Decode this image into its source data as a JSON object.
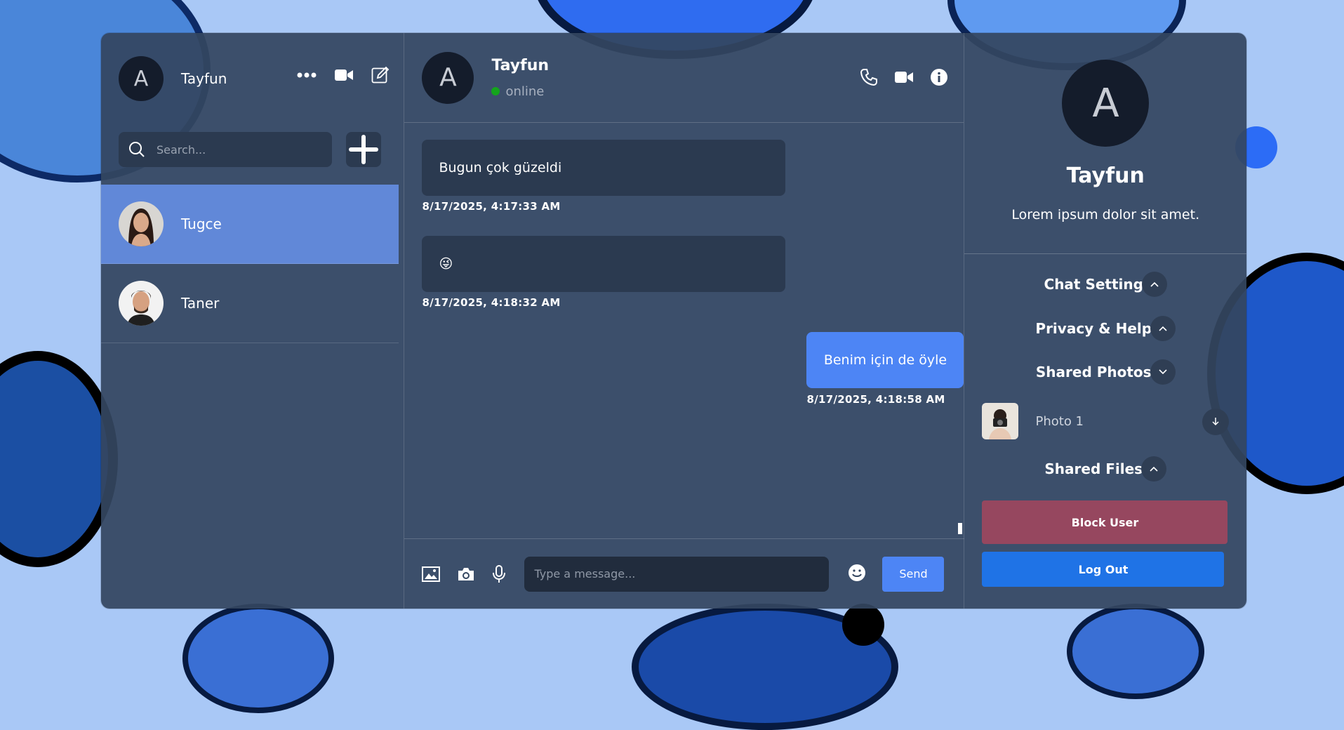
{
  "sidebar": {
    "user": {
      "initial": "A",
      "name": "Tayfun"
    },
    "search": {
      "placeholder": "Search..."
    },
    "contacts": [
      {
        "name": "Tugce",
        "active": true
      },
      {
        "name": "Taner",
        "active": false
      }
    ]
  },
  "chat": {
    "header": {
      "initial": "A",
      "name": "Tayfun",
      "status": "online"
    },
    "messages": [
      {
        "text": "Bugun çok güzeldi",
        "time": "8/17/2025, 4:17:33 AM",
        "direction": "in"
      },
      {
        "text": "😜",
        "time": "8/17/2025, 4:18:32 AM",
        "direction": "in"
      },
      {
        "text": "Benim için de öyle",
        "time": "8/17/2025, 4:18:58 AM",
        "direction": "out"
      }
    ],
    "composer": {
      "placeholder": "Type a message...",
      "send_label": "Send"
    }
  },
  "details": {
    "initial": "A",
    "name": "Tayfun",
    "description": "Lorem ipsum dolor sit amet.",
    "sections": {
      "chat_setting": "Chat Setting",
      "privacy_help": "Privacy & Help",
      "shared_photos": "Shared Photos",
      "shared_files": "Shared Files"
    },
    "photos": [
      {
        "label": "Photo 1"
      }
    ],
    "block_label": "Block User",
    "logout_label": "Log Out"
  },
  "colors": {
    "accent": "#4d85f5",
    "active_contact": "#6188d8",
    "danger": "#96475f",
    "online": "#14a51c",
    "logout": "#1f73e6"
  },
  "icons": [
    "more-icon",
    "video-icon",
    "edit-icon",
    "search-icon",
    "plus-icon",
    "phone-icon",
    "info-icon",
    "image-icon",
    "camera-icon",
    "mic-icon",
    "emoji-icon",
    "chevron-up-icon",
    "chevron-down-icon",
    "download-icon"
  ]
}
